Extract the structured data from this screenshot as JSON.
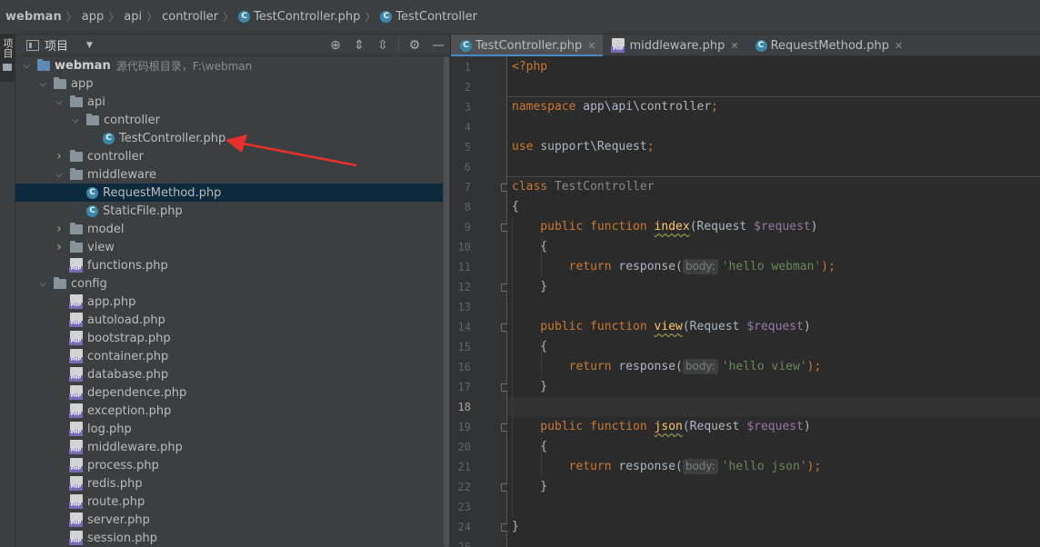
{
  "breadcrumb": [
    {
      "label": "webman",
      "bold": true,
      "icon": ""
    },
    {
      "label": "app",
      "bold": false,
      "icon": ""
    },
    {
      "label": "api",
      "bold": false,
      "icon": ""
    },
    {
      "label": "controller",
      "bold": false,
      "icon": ""
    },
    {
      "label": "TestController.php",
      "bold": false,
      "icon": "C"
    },
    {
      "label": "TestController",
      "bold": false,
      "icon": "C"
    }
  ],
  "tool_stripe": {
    "label": "项目"
  },
  "project_panel": {
    "title": "项目",
    "dropdown_icon": "▼",
    "actions": [
      {
        "name": "locate-icon",
        "glyph": "⊕"
      },
      {
        "name": "expand-all-icon",
        "glyph": "⇕"
      },
      {
        "name": "collapse-all-icon",
        "glyph": "⇳"
      },
      {
        "name": "settings-gear-icon",
        "glyph": "⚙"
      },
      {
        "name": "hide-icon",
        "glyph": "—"
      }
    ]
  },
  "tree": [
    {
      "label": "webman",
      "hint": "源代码根目录，F:\\webman",
      "depth": 0,
      "type": "root",
      "expanded": true
    },
    {
      "label": "app",
      "depth": 1,
      "type": "folder",
      "expanded": true
    },
    {
      "label": "api",
      "depth": 2,
      "type": "folder",
      "expanded": true
    },
    {
      "label": "controller",
      "depth": 3,
      "type": "folder",
      "expanded": true
    },
    {
      "label": "TestController.php",
      "depth": 4,
      "type": "class"
    },
    {
      "label": "controller",
      "depth": 2,
      "type": "folder",
      "expanded": false
    },
    {
      "label": "middleware",
      "depth": 2,
      "type": "folder",
      "expanded": true
    },
    {
      "label": "RequestMethod.php",
      "depth": 3,
      "type": "class",
      "selected": true
    },
    {
      "label": "StaticFile.php",
      "depth": 3,
      "type": "class"
    },
    {
      "label": "model",
      "depth": 2,
      "type": "folder",
      "expanded": false
    },
    {
      "label": "view",
      "depth": 2,
      "type": "folder",
      "expanded": false
    },
    {
      "label": "functions.php",
      "depth": 2,
      "type": "php"
    },
    {
      "label": "config",
      "depth": 1,
      "type": "folder",
      "expanded": true
    },
    {
      "label": "app.php",
      "depth": 2,
      "type": "php"
    },
    {
      "label": "autoload.php",
      "depth": 2,
      "type": "php"
    },
    {
      "label": "bootstrap.php",
      "depth": 2,
      "type": "php"
    },
    {
      "label": "container.php",
      "depth": 2,
      "type": "php"
    },
    {
      "label": "database.php",
      "depth": 2,
      "type": "php"
    },
    {
      "label": "dependence.php",
      "depth": 2,
      "type": "php"
    },
    {
      "label": "exception.php",
      "depth": 2,
      "type": "php"
    },
    {
      "label": "log.php",
      "depth": 2,
      "type": "php"
    },
    {
      "label": "middleware.php",
      "depth": 2,
      "type": "php"
    },
    {
      "label": "process.php",
      "depth": 2,
      "type": "php"
    },
    {
      "label": "redis.php",
      "depth": 2,
      "type": "php"
    },
    {
      "label": "route.php",
      "depth": 2,
      "type": "php"
    },
    {
      "label": "server.php",
      "depth": 2,
      "type": "php"
    },
    {
      "label": "session.php",
      "depth": 2,
      "type": "php"
    }
  ],
  "tabs": [
    {
      "label": "TestController.php",
      "icon": "class",
      "active": true
    },
    {
      "label": "middleware.php",
      "icon": "php",
      "active": false
    },
    {
      "label": "RequestMethod.php",
      "icon": "class",
      "active": false
    }
  ],
  "tab_close_glyph": "✕",
  "editor": {
    "current_line": 18,
    "line_numbers": [
      "1",
      "2",
      "3",
      "4",
      "5",
      "6",
      "7",
      "8",
      "9",
      "10",
      "11",
      "12",
      "13",
      "14",
      "15",
      "16",
      "17",
      "18",
      "19",
      "20",
      "21",
      "22",
      "23",
      "24",
      "25"
    ],
    "lines": [
      [
        {
          "t": "<?php",
          "c": "ph"
        }
      ],
      [],
      [
        {
          "t": "namespace ",
          "c": "kw"
        },
        {
          "t": "app\\api\\controller",
          "c": "plain"
        },
        {
          "t": ";",
          "c": "kw"
        }
      ],
      [],
      [
        {
          "t": "use ",
          "c": "kw"
        },
        {
          "t": "support\\Request",
          "c": "plain"
        },
        {
          "t": ";",
          "c": "kw"
        }
      ],
      [],
      [
        {
          "t": "class ",
          "c": "kw"
        },
        {
          "t": "TestController",
          "c": "cls-def"
        }
      ],
      [
        {
          "t": "{",
          "c": "plain"
        }
      ],
      [
        {
          "t": "    public ",
          "c": "kw"
        },
        {
          "t": "function ",
          "c": "kw"
        },
        {
          "t": "index",
          "c": "fn"
        },
        {
          "t": "(Request ",
          "c": "plain"
        },
        {
          "t": "$request",
          "c": "var"
        },
        {
          "t": ")",
          "c": "plain"
        }
      ],
      [
        {
          "t": "    {",
          "c": "plain"
        }
      ],
      [
        {
          "t": "        return ",
          "c": "kw"
        },
        {
          "t": "response(",
          "c": "plain"
        },
        {
          "t": "body:",
          "c": "hint"
        },
        {
          "t": "'hello webman'",
          "c": "str"
        },
        {
          "t": ");",
          "c": "kw"
        }
      ],
      [
        {
          "t": "    }",
          "c": "plain"
        }
      ],
      [],
      [
        {
          "t": "    public ",
          "c": "kw"
        },
        {
          "t": "function ",
          "c": "kw"
        },
        {
          "t": "view",
          "c": "fn"
        },
        {
          "t": "(Request ",
          "c": "plain"
        },
        {
          "t": "$request",
          "c": "var"
        },
        {
          "t": ")",
          "c": "plain"
        }
      ],
      [
        {
          "t": "    {",
          "c": "plain"
        }
      ],
      [
        {
          "t": "        return ",
          "c": "kw"
        },
        {
          "t": "response(",
          "c": "plain"
        },
        {
          "t": "body:",
          "c": "hint"
        },
        {
          "t": "'hello view'",
          "c": "str"
        },
        {
          "t": ");",
          "c": "kw"
        }
      ],
      [
        {
          "t": "    }",
          "c": "plain"
        }
      ],
      [],
      [
        {
          "t": "    public ",
          "c": "kw"
        },
        {
          "t": "function ",
          "c": "kw"
        },
        {
          "t": "json",
          "c": "fn"
        },
        {
          "t": "(Request ",
          "c": "plain"
        },
        {
          "t": "$request",
          "c": "var"
        },
        {
          "t": ")",
          "c": "plain"
        }
      ],
      [
        {
          "t": "    {",
          "c": "plain"
        }
      ],
      [
        {
          "t": "        return ",
          "c": "kw"
        },
        {
          "t": "response(",
          "c": "plain"
        },
        {
          "t": "body:",
          "c": "hint"
        },
        {
          "t": "'hello json'",
          "c": "str"
        },
        {
          "t": ");",
          "c": "kw"
        }
      ],
      [
        {
          "t": "    }",
          "c": "plain"
        }
      ],
      [],
      [
        {
          "t": "}",
          "c": "plain"
        }
      ],
      []
    ],
    "folds": [
      7,
      9,
      12,
      14,
      17,
      19,
      22,
      24
    ]
  },
  "colors": {
    "accent": "#4a88c7",
    "annotation": "#e8302a",
    "selection": "#0d293e"
  }
}
